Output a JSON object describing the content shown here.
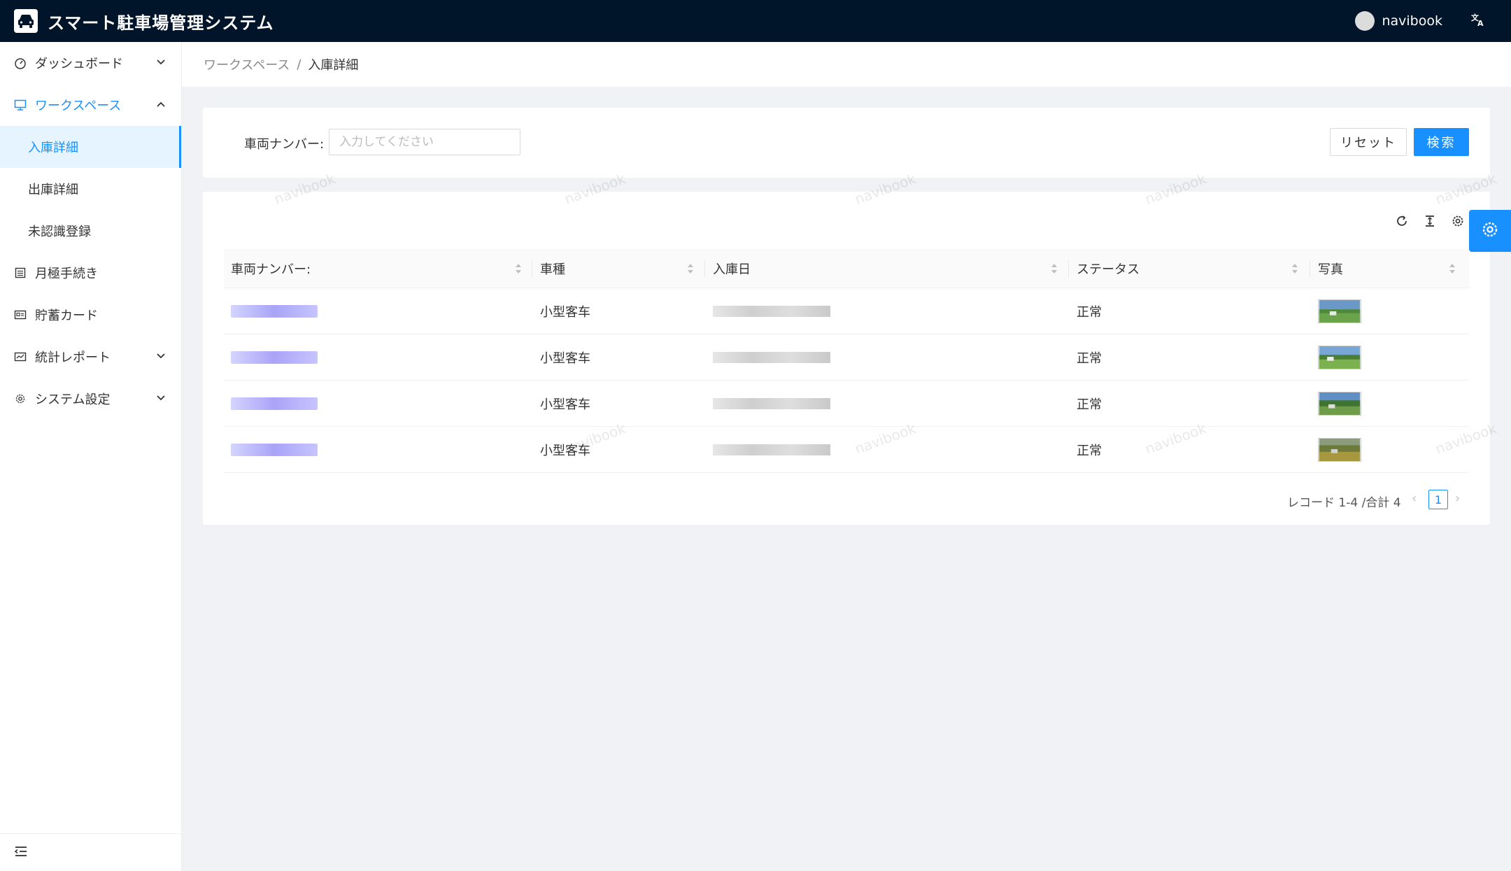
{
  "app": {
    "title": "スマート駐車場管理システム",
    "username": "navibook",
    "lang_icon": "translate-icon"
  },
  "sidebar": {
    "items": [
      {
        "label": "ダッシュボード",
        "icon": "dashboard-icon",
        "expandable": true,
        "open": false
      },
      {
        "label": "ワークスペース",
        "icon": "monitor-icon",
        "expandable": true,
        "open": true,
        "children": [
          {
            "label": "入庫詳細",
            "active": true
          },
          {
            "label": "出庫詳細",
            "active": false
          },
          {
            "label": "未認識登録",
            "active": false
          }
        ]
      },
      {
        "label": "月極手続き",
        "icon": "list-icon",
        "expandable": false
      },
      {
        "label": "貯蓄カード",
        "icon": "card-icon",
        "expandable": false
      },
      {
        "label": "統計レポート",
        "icon": "report-icon",
        "expandable": true,
        "open": false
      },
      {
        "label": "システム設定",
        "icon": "gear-icon",
        "expandable": true,
        "open": false
      }
    ]
  },
  "breadcrumb": {
    "items": [
      "ワークスペース",
      "入庫詳細"
    ],
    "separator": "/"
  },
  "search": {
    "label": "車両ナンバー:",
    "placeholder": "入力してください",
    "value": "",
    "reset_label": "リセット",
    "search_label": "検索"
  },
  "table": {
    "columns": [
      "車両ナンバー:",
      "車種",
      "入庫日",
      "ステータス",
      "写真"
    ],
    "rows": [
      {
        "plate": "",
        "type": "小型客车",
        "date": "",
        "status": "正常",
        "photo": "photo-thumbnail"
      },
      {
        "plate": "",
        "type": "小型客车",
        "date": "",
        "status": "正常",
        "photo": "photo-thumbnail"
      },
      {
        "plate": "",
        "type": "小型客车",
        "date": "",
        "status": "正常",
        "photo": "photo-thumbnail"
      },
      {
        "plate": "",
        "type": "小型客车",
        "date": "",
        "status": "正常",
        "photo": "photo-thumbnail"
      }
    ]
  },
  "pagination": {
    "summary": "レコード 1-4 /合計 4",
    "current_page": "1"
  },
  "watermark": "navibook",
  "colors": {
    "header_bg": "#001529",
    "accent": "#1890ff",
    "active_bg": "#e6f4ff",
    "page_bg": "#f0f2f5"
  }
}
